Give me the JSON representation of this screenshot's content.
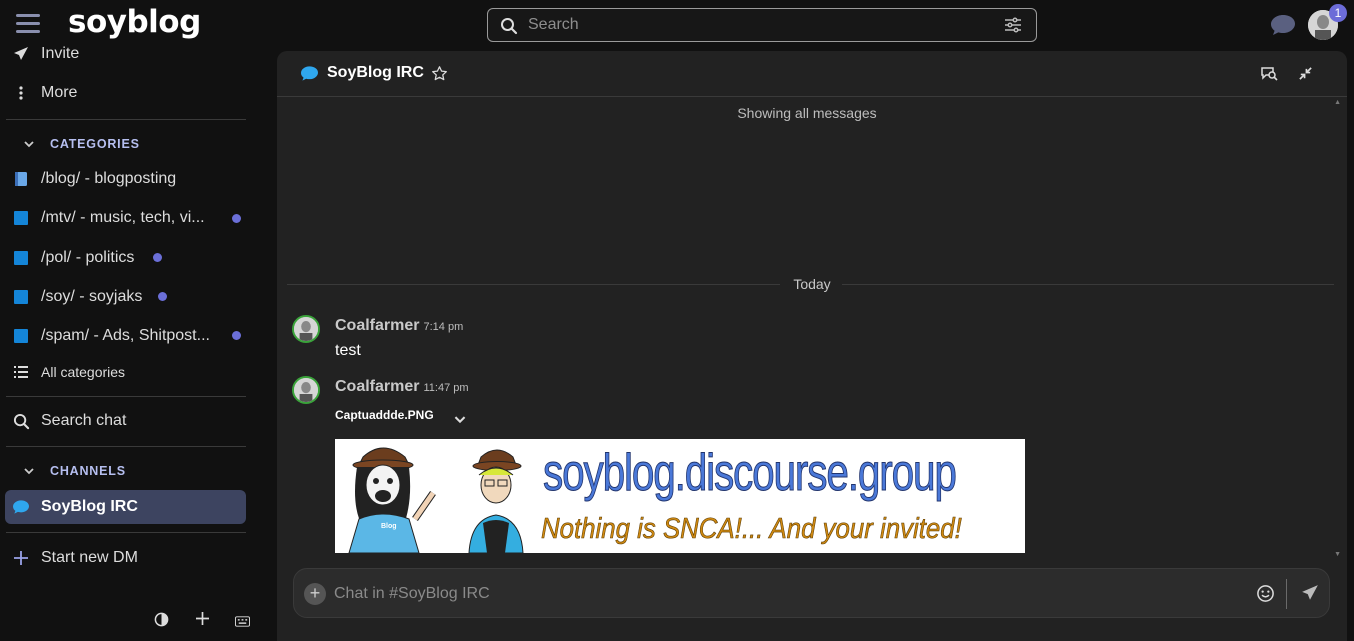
{
  "header": {
    "logo": "soyblog",
    "search_placeholder": "Search",
    "notification_count": "1"
  },
  "sidebar": {
    "top_items": [
      {
        "label": "Invite",
        "icon": "paper-plane-icon"
      },
      {
        "label": "More",
        "icon": "vertical-ellipsis-icon"
      }
    ],
    "categories_heading": "CATEGORIES",
    "categories": [
      {
        "label": "/blog/ - blogposting",
        "icon": "book-icon",
        "unread": false
      },
      {
        "label": "/mtv/ - music, tech, vi...",
        "color": "#1485d8",
        "unread": true
      },
      {
        "label": "/pol/ - politics",
        "color": "#1485d8",
        "unread": true
      },
      {
        "label": "/soy/ - soyjaks",
        "color": "#1485d8",
        "unread": true
      },
      {
        "label": "/spam/ - Ads, Shitpost...",
        "color": "#1485d8",
        "unread": true
      }
    ],
    "all_categories": "All categories",
    "search_chat": "Search chat",
    "channels_heading": "CHANNELS",
    "channels": [
      {
        "label": "SoyBlog IRC",
        "active": true
      }
    ],
    "start_dm": "Start new DM"
  },
  "chat": {
    "channel_title": "SoyBlog IRC",
    "showing_all": "Showing all messages",
    "date_divider": "Today",
    "messages": [
      {
        "user": "Coalfarmer",
        "time": "7:14 pm",
        "text": "test"
      },
      {
        "user": "Coalfarmer",
        "time": "11:47 pm",
        "attachment": "Captuaddde.PNG"
      }
    ],
    "banner": {
      "title": "soyblog.discourse.group",
      "subtitle": "Nothing is SNCA!... And your invited!",
      "shirt_text": "Blog"
    },
    "composer_placeholder": "Chat in #SoyBlog IRC"
  },
  "colors": {
    "accent": "#6b6fd8",
    "category": "#1485d8",
    "chat_bubble": "#2fa7ee",
    "active_channel": "#3d4460"
  }
}
